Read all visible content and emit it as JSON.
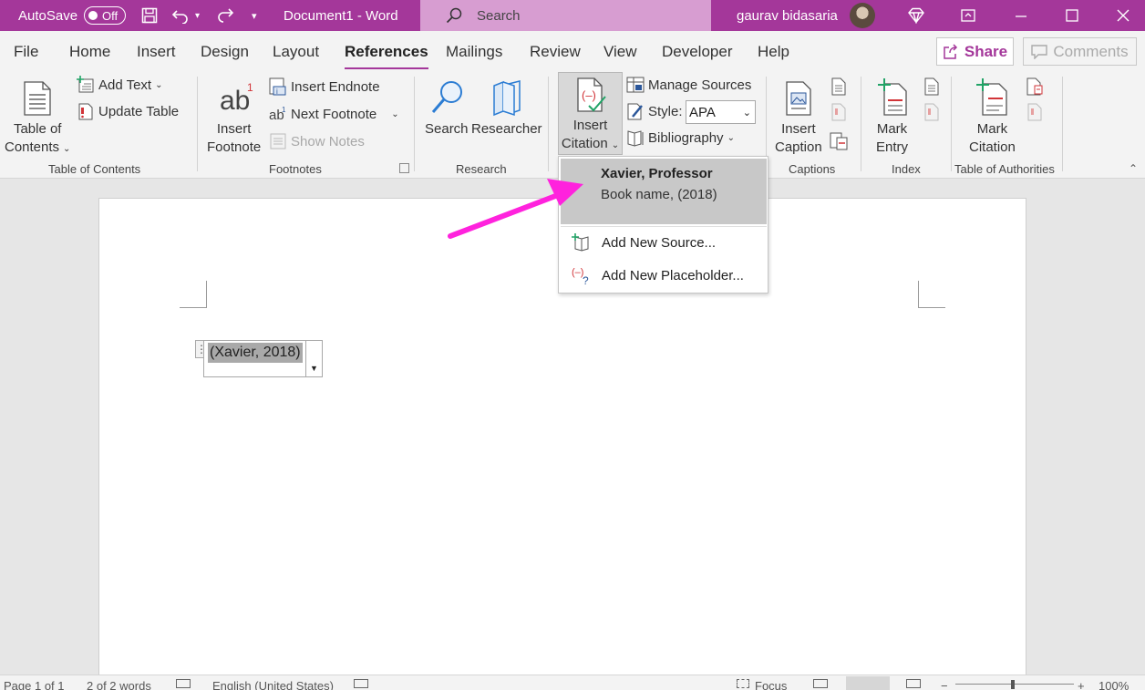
{
  "titlebar": {
    "autosave_label": "AutoSave",
    "autosave_state": "Off",
    "document_title": "Document1  -  Word",
    "search_placeholder": "Search",
    "user_name": "gaurav bidasaria",
    "accent_color": "#a4379a"
  },
  "tabs": [
    {
      "label": "File"
    },
    {
      "label": "Home"
    },
    {
      "label": "Insert"
    },
    {
      "label": "Design"
    },
    {
      "label": "Layout"
    },
    {
      "label": "References"
    },
    {
      "label": "Mailings"
    },
    {
      "label": "Review"
    },
    {
      "label": "View"
    },
    {
      "label": "Developer"
    },
    {
      "label": "Help"
    }
  ],
  "active_tab": "References",
  "share_label": "Share",
  "comments_label": "Comments",
  "ribbon": {
    "toc": {
      "group_label": "Table of Contents",
      "toc_line1": "Table of",
      "toc_line2": "Contents",
      "add_text": "Add Text",
      "update_table": "Update Table"
    },
    "footnotes": {
      "group_label": "Footnotes",
      "insert_footnote_line1": "Insert",
      "insert_footnote_line2": "Footnote",
      "insert_endnote": "Insert Endnote",
      "next_footnote": "Next Footnote",
      "show_notes": "Show Notes"
    },
    "research": {
      "group_label": "Research",
      "search": "Search",
      "researcher": "Researcher"
    },
    "citations": {
      "insert_citation_line1": "Insert",
      "insert_citation_line2": "Citation",
      "manage_sources": "Manage Sources",
      "style_label": "Style:",
      "style_value": "APA",
      "bibliography": "Bibliography"
    },
    "captions": {
      "group_label": "Captions",
      "insert_caption_line1": "Insert",
      "insert_caption_line2": "Caption"
    },
    "index": {
      "group_label": "Index",
      "mark_entry_line1": "Mark",
      "mark_entry_line2": "Entry"
    },
    "authorities": {
      "group_label": "Table of Authorities",
      "mark_citation_line1": "Mark",
      "mark_citation_line2": "Citation"
    }
  },
  "citation_menu": {
    "source_author": "Xavier, Professor",
    "source_detail": "Book name, (2018)",
    "add_new_source": "Add New Source...",
    "add_new_placeholder": "Add New Placeholder..."
  },
  "document": {
    "citation_text": "(Xavier, 2018)"
  },
  "statusbar": {
    "page": "Page 1 of 1",
    "words": "2 of 2 words",
    "language": "English (United States)",
    "focus": "Focus",
    "zoom": "100%"
  },
  "annotation_arrow_color": "#ff22dd"
}
